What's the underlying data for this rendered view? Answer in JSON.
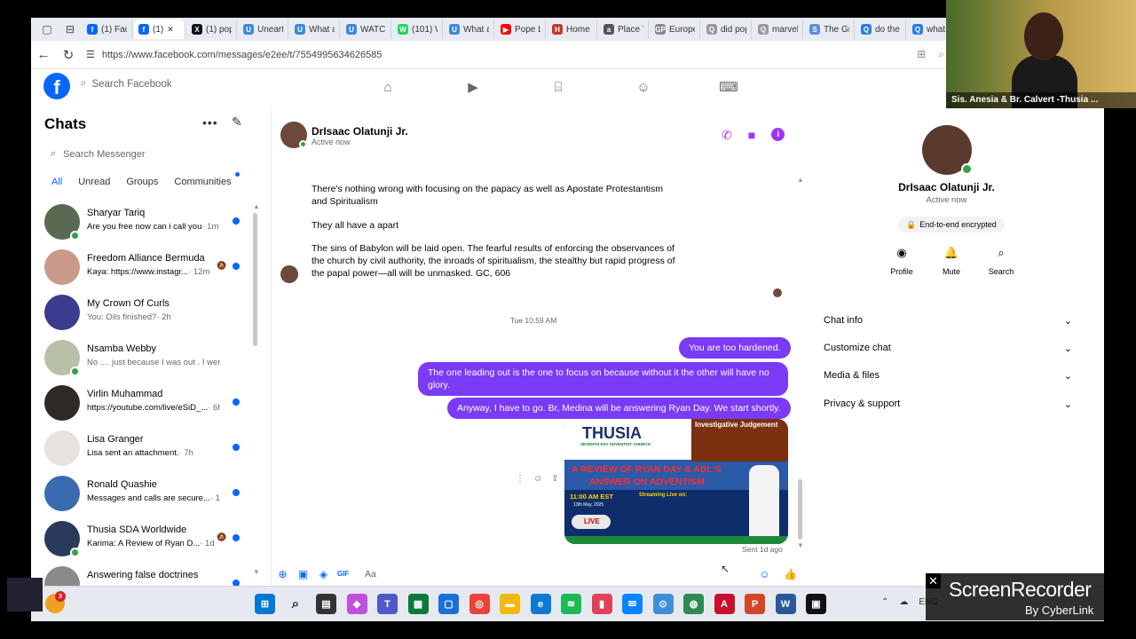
{
  "browser": {
    "tabs": [
      {
        "label": "(1) Face",
        "fav": "f",
        "color": "#0866ff"
      },
      {
        "label": "(1)",
        "fav": "f",
        "color": "#0866ff",
        "active": true
      },
      {
        "label": "(1) pop",
        "fav": "X",
        "color": "#111111"
      },
      {
        "label": "Unearth",
        "fav": "U",
        "color": "#3b8bd8"
      },
      {
        "label": "What a",
        "fav": "U",
        "color": "#3b8bd8"
      },
      {
        "label": "WATCH",
        "fav": "U",
        "color": "#3b8bd8"
      },
      {
        "label": "(101) W",
        "fav": "W",
        "color": "#25d366"
      },
      {
        "label": "What a",
        "fav": "U",
        "color": "#3b8bd8"
      },
      {
        "label": "Pope L",
        "fav": "▶",
        "color": "#ff0000"
      },
      {
        "label": "Home",
        "fav": "H",
        "color": "#c0392b"
      },
      {
        "label": "Place Y",
        "fav": "a",
        "color": "#555555"
      },
      {
        "label": "Europe",
        "fav": "GP",
        "color": "#888888"
      },
      {
        "label": "did pop",
        "fav": "Q",
        "color": "#999999"
      },
      {
        "label": "marvel",
        "fav": "Q",
        "color": "#999999"
      },
      {
        "label": "The Gr",
        "fav": "S",
        "color": "#5b8dd8"
      },
      {
        "label": "do the",
        "fav": "Q",
        "color": "#2b7de9"
      },
      {
        "label": "what d",
        "fav": "Q",
        "color": "#2b7de9"
      }
    ],
    "url": "https://www.facebook.com/messages/e2ee/t/7554995634626585"
  },
  "facebook": {
    "search_placeholder": "Search Facebook"
  },
  "chats": {
    "title": "Chats",
    "search_placeholder": "Search Messenger",
    "filters": [
      "All",
      "Unread",
      "Groups",
      "Communities"
    ],
    "items": [
      {
        "name": "Sharyar Tariq",
        "preview": "Are you free now can i call you",
        "time": "· 1m",
        "unread": true,
        "online": true,
        "muted": false,
        "color": "#5a6a52"
      },
      {
        "name": "Freedom Alliance Bermuda",
        "preview": "Kaya: https://www.instagr...",
        "time": "· 12m",
        "unread": true,
        "online": false,
        "muted": true,
        "color": "#c99a8a"
      },
      {
        "name": "My Crown Of Curls",
        "preview": "You: Oils finished?",
        "time": "· 2h",
        "unread": false,
        "online": false,
        "muted": false,
        "color": "#3b3b8f"
      },
      {
        "name": "Nsamba Webby",
        "preview": "No .... just because I was out . I wen...",
        "time": "· 5h",
        "unread": false,
        "online": true,
        "muted": false,
        "color": "#b8c0a8"
      },
      {
        "name": "Virlin Muhammad",
        "preview": "https://youtube.com/live/eSiD_...",
        "time": "· 6h",
        "unread": true,
        "online": false,
        "muted": false,
        "color": "#2e2a26"
      },
      {
        "name": "Lisa Granger",
        "preview": "Lisa sent an attachment.",
        "time": "· 7h",
        "unread": true,
        "online": false,
        "muted": false,
        "color": "#e6e2dc"
      },
      {
        "name": "Ronald Quashie",
        "preview": "Messages and calls are secure...",
        "time": "· 15h",
        "unread": true,
        "online": false,
        "muted": false,
        "color": "#3a6ab0"
      },
      {
        "name": "Thusia SDA Worldwide",
        "preview": "Karima: A Review of Ryan D...",
        "time": "· 1d",
        "unread": true,
        "online": true,
        "muted": true,
        "color": "#2a3a5a"
      },
      {
        "name": "Answering false doctrines",
        "preview": "",
        "time": "",
        "unread": true,
        "online": false,
        "muted": false,
        "color": "#8a8a8a"
      }
    ]
  },
  "conversation": {
    "name": "DrIsaac Olatunji Jr.",
    "status": "Active now",
    "incoming": [
      "There's nothing wrong with focusing on the papacy as well as Apostate Protestantism and Spiritualism",
      "They all have a apart",
      "The sins of Babylon will be laid open. The fearful results of enforcing the observances of the church by civil authority, the inroads of spiritualism, the stealthy but rapid progress of the papal power—all will be unmasked. GC, 606"
    ],
    "timestamp": "Tue 10:59 AM",
    "outgoing": [
      "You are too hardened.",
      "The one leading out is the one to focus on because without it the other will have no glory.",
      "Anyway, I have to go. Br, Medina will be answering Ryan Day. We start shortly."
    ],
    "attachment": {
      "brand": "THUSIA",
      "brand_sub": "SEVENTH DAY ADVENTIST CHURCH",
      "banner": "Investigative Judgement",
      "title_line1": "A REVIEW OF RYAN DAY & ADL'S",
      "title_line2": "ANSWER ON ADVENTISM",
      "time": "11:00 AM EST",
      "date": "13th May, 2025",
      "live": "LIVE",
      "streaming": "Streaming Live on:"
    },
    "sent_label": "Sent 1d ago",
    "composer_placeholder": "Aa"
  },
  "info_panel": {
    "name": "DrIsaac Olatunji Jr.",
    "status": "Active now",
    "encrypted": "End-to-end encrypted",
    "actions": [
      "Profile",
      "Mute",
      "Search"
    ],
    "sections": [
      "Chat info",
      "Customize chat",
      "Media & files",
      "Privacy & support"
    ]
  },
  "webcam": {
    "caption": "Sis. Anesia & Br. Calvert -Thusia ..."
  },
  "recorder": {
    "title": "ScreenRecorder",
    "subtitle": "By CyberLink"
  },
  "taskbar": {
    "weather_badge": "3",
    "tray_lang": "ENG"
  }
}
